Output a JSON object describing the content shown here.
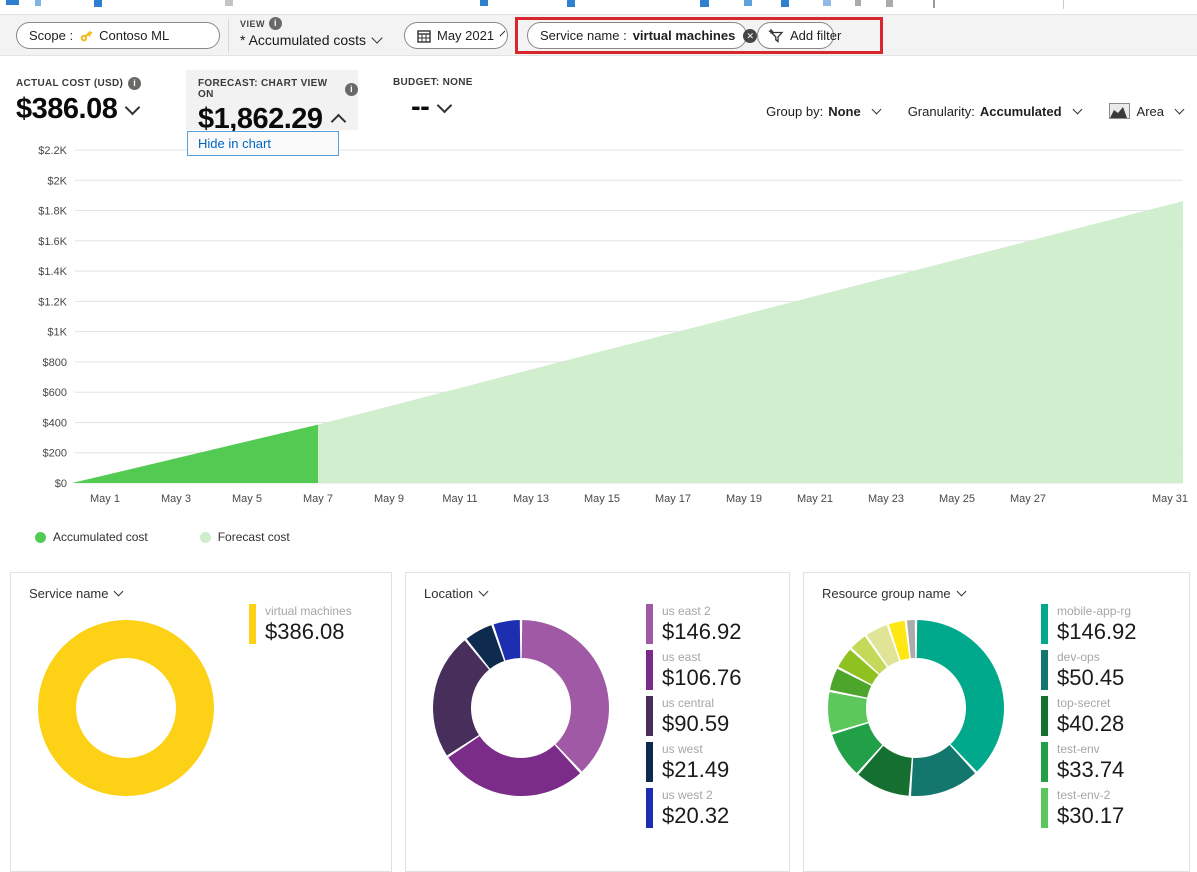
{
  "toolbar": {
    "scope_label": "Scope :",
    "scope_value": "Contoso ML",
    "view_label": "VIEW",
    "view_value": "* Accumulated costs",
    "date_value": "May 2021",
    "filter_label": "Service name :",
    "filter_value": "virtual machines",
    "add_filter_label": "Add filter"
  },
  "kpis": {
    "actual": {
      "label": "ACTUAL COST (USD)",
      "value": "$386.08"
    },
    "forecast": {
      "label": "FORECAST: CHART VIEW ON",
      "value": "$1,862.29"
    },
    "budget": {
      "label": "BUDGET: NONE",
      "value": "--"
    },
    "forecast_menu_item": "Hide in chart"
  },
  "controls": {
    "group_by_label": "Group by:",
    "group_by_value": "None",
    "granularity_label": "Granularity:",
    "granularity_value": "Accumulated",
    "chart_type_label": "Area"
  },
  "colors": {
    "accumulated": "#53cb53",
    "forecast": "#cdedcb",
    "highlight_red": "#d8252e",
    "accent_blue": "#0065c0"
  },
  "chart_data": [
    {
      "type": "area",
      "title": "Accumulated and forecast cost, May 2021",
      "ylim": [
        0,
        2200
      ],
      "grid": true,
      "legend_position": "bottom",
      "series": [
        {
          "name": "Accumulated cost",
          "color": "#53cb53",
          "points": [
            {
              "day": 1,
              "value": 0
            },
            {
              "day": 7,
              "value": 386.08
            }
          ]
        },
        {
          "name": "Forecast cost",
          "color": "#cdedcb",
          "points": [
            {
              "day": 7,
              "value": 386.08
            },
            {
              "day": 31,
              "value": 1862.29
            }
          ]
        }
      ],
      "yticks": [
        {
          "value": 0,
          "label": "$0"
        },
        {
          "value": 200,
          "label": "$200"
        },
        {
          "value": 400,
          "label": "$400"
        },
        {
          "value": 600,
          "label": "$600"
        },
        {
          "value": 800,
          "label": "$800"
        },
        {
          "value": 1000,
          "label": "$1K"
        },
        {
          "value": 1200,
          "label": "$1.2K"
        },
        {
          "value": 1400,
          "label": "$1.4K"
        },
        {
          "value": 1600,
          "label": "$1.6K"
        },
        {
          "value": 1800,
          "label": "$1.8K"
        },
        {
          "value": 2000,
          "label": "$2K"
        },
        {
          "value": 2200,
          "label": "$2.2K"
        }
      ],
      "xticks": [
        {
          "day": 1,
          "label": "May 1"
        },
        {
          "day": 3,
          "label": "May 3"
        },
        {
          "day": 5,
          "label": "May 5"
        },
        {
          "day": 7,
          "label": "May 7"
        },
        {
          "day": 9,
          "label": "May 9"
        },
        {
          "day": 11,
          "label": "May 11"
        },
        {
          "day": 13,
          "label": "May 13"
        },
        {
          "day": 15,
          "label": "May 15"
        },
        {
          "day": 17,
          "label": "May 17"
        },
        {
          "day": 19,
          "label": "May 19"
        },
        {
          "day": 21,
          "label": "May 21"
        },
        {
          "day": 23,
          "label": "May 23"
        },
        {
          "day": 25,
          "label": "May 25"
        },
        {
          "day": 27,
          "label": "May 27"
        },
        {
          "day": 31,
          "label": "May 31"
        }
      ]
    },
    {
      "type": "pie",
      "title": "Service name",
      "segments": [
        {
          "label": "virtual machines",
          "value": 386.08,
          "color": "#fcd116"
        }
      ]
    },
    {
      "type": "pie",
      "title": "Location",
      "segments": [
        {
          "label": "us east 2",
          "value": 146.92,
          "color": "#a05aa5"
        },
        {
          "label": "us east",
          "value": 106.76,
          "color": "#7a2c88"
        },
        {
          "label": "us central",
          "value": 90.59,
          "color": "#472e5b"
        },
        {
          "label": "us west",
          "value": 21.49,
          "color": "#0f2a4f"
        },
        {
          "label": "us west 2",
          "value": 20.32,
          "color": "#1b2fb0"
        }
      ]
    },
    {
      "type": "pie",
      "title": "Resource group name",
      "segments": [
        {
          "label": "mobile-app-rg",
          "value": 146.92,
          "color": "#00a98b"
        },
        {
          "label": "dev-ops",
          "value": 50.45,
          "color": "#13776d"
        },
        {
          "label": "top-secret",
          "value": 40.28,
          "color": "#146f31"
        },
        {
          "label": "test-env",
          "value": 33.74,
          "color": "#21a047"
        },
        {
          "label": "test-env-2",
          "value": 30.17,
          "color": "#5cc85c"
        },
        {
          "label": null,
          "value": 17.2,
          "color": "#4ea52c",
          "estimated": true
        },
        {
          "label": null,
          "value": 16.1,
          "color": "#8fc120",
          "estimated": true
        },
        {
          "label": null,
          "value": 13.9,
          "color": "#c4d95a",
          "estimated": true
        },
        {
          "label": null,
          "value": 17.2,
          "color": "#e1e496",
          "estimated": true
        },
        {
          "label": null,
          "value": 12.9,
          "color": "#ffe713",
          "estimated": true
        },
        {
          "label": null,
          "value": 7.2,
          "color": "#ababab",
          "estimated": true
        }
      ]
    }
  ]
}
